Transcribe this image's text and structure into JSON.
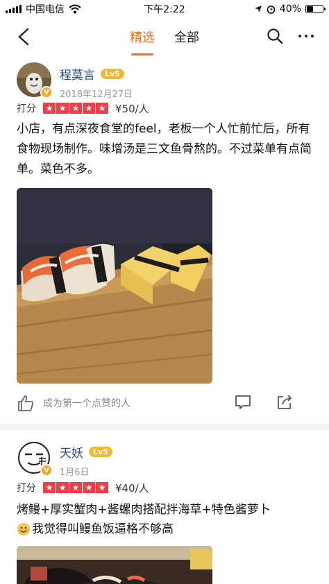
{
  "status_bar": {
    "carrier": "中国电信",
    "time": "下午2:22",
    "battery": "40%",
    "battery_level": 0.4
  },
  "nav": {
    "tabs": [
      {
        "label": "精选",
        "active": true
      },
      {
        "label": "全部",
        "active": false
      }
    ],
    "icons": [
      "back-arrow-icon",
      "search-icon",
      "more-icon"
    ]
  },
  "reviews": [
    {
      "username": "程莫言",
      "level": "Lv5",
      "date": "2018年12月27日",
      "rating_label": "打分",
      "stars": 5,
      "price": "¥50/人",
      "text": "小店，有点深夜食堂的feel，老板一个人忙前忙后，所有食物现场制作。味增汤是三文鱼骨熬的。不过菜单有点简单。菜色不多。",
      "like_text": "成为第一个点赞的人"
    },
    {
      "username": "天妖",
      "level": "Lv5",
      "date": "1月6日",
      "rating_label": "打分",
      "stars": 5,
      "price": "¥40/人",
      "text_line1": "烤鳗+厚实蟹肉+酱螺肉搭配拌海草+特色酱萝卜",
      "text_line2": "我觉得叫鳗鱼饭逼格不够高"
    }
  ],
  "colors": {
    "accent": "#f26b1d",
    "star": "#ef3d4a",
    "level_badge": "#f5b82e",
    "username": "#2a4a85"
  }
}
